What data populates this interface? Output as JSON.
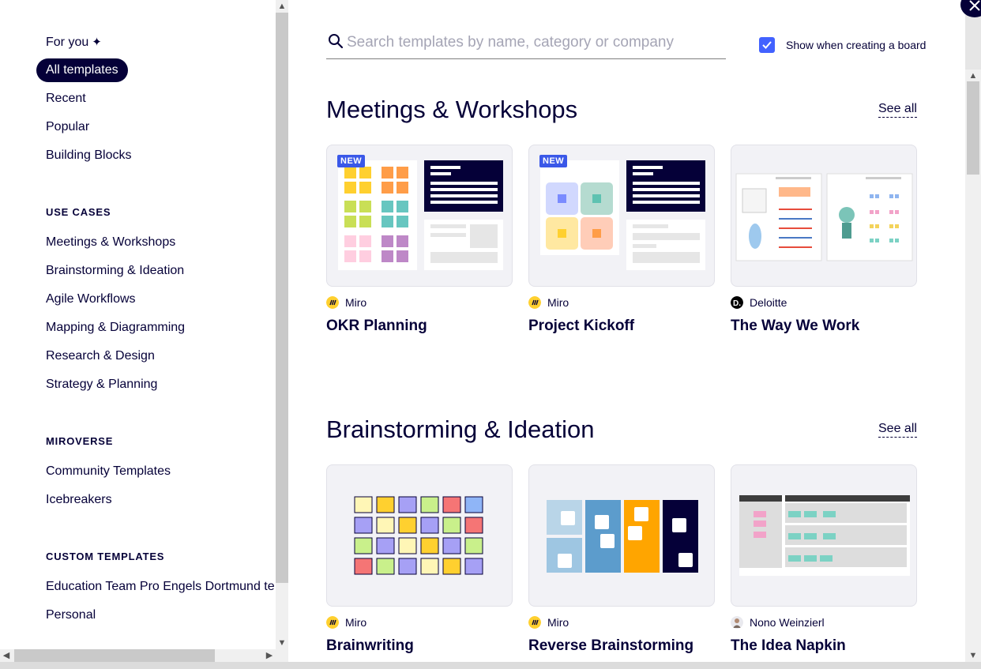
{
  "sidebar": {
    "top_items": [
      {
        "label": "For you"
      },
      {
        "label": "All templates",
        "active": true
      },
      {
        "label": "Recent"
      },
      {
        "label": "Popular"
      },
      {
        "label": "Building Blocks"
      }
    ],
    "use_cases": {
      "title": "USE CASES",
      "items": [
        "Meetings & Workshops",
        "Brainstorming & Ideation",
        "Agile Workflows",
        "Mapping & Diagramming",
        "Research & Design",
        "Strategy & Planning"
      ]
    },
    "miroverse": {
      "title": "MIROVERSE",
      "items": [
        "Community Templates",
        "Icebreakers"
      ]
    },
    "custom_templates": {
      "title": "CUSTOM TEMPLATES",
      "items": [
        "Education Team Pro Engels Dortmund te",
        "Personal"
      ]
    }
  },
  "search": {
    "placeholder": "Search templates by name, category or company"
  },
  "show_when_creating": {
    "label": "Show when creating a board",
    "checked": true
  },
  "sections": [
    {
      "title": "Meetings & Workshops",
      "see_all": "See all",
      "cards": [
        {
          "badge": "NEW",
          "author": "Miro",
          "title": "OKR Planning",
          "logo": "miro-logo"
        },
        {
          "badge": "NEW",
          "author": "Miro",
          "title": "Project Kickoff",
          "logo": "miro-logo"
        },
        {
          "badge": "",
          "author": "Deloitte",
          "title": "The Way We Work",
          "logo": "deloitte-logo"
        }
      ]
    },
    {
      "title": "Brainstorming & Ideation",
      "see_all": "See all",
      "cards": [
        {
          "badge": "",
          "author": "Miro",
          "title": "Brainwriting",
          "logo": "miro-logo"
        },
        {
          "badge": "",
          "author": "Miro",
          "title": "Reverse Brainstorming",
          "logo": "miro-logo"
        },
        {
          "badge": "",
          "author": "Nono Weinzierl",
          "title": "The Idea Napkin",
          "logo": "avatar"
        }
      ]
    }
  ],
  "colors": {
    "ink": "#050038",
    "accent": "#4262ff",
    "badge": "#3a58e8",
    "miro_yellow": "#ffd02f",
    "card_bg": "#f2f2f6"
  }
}
